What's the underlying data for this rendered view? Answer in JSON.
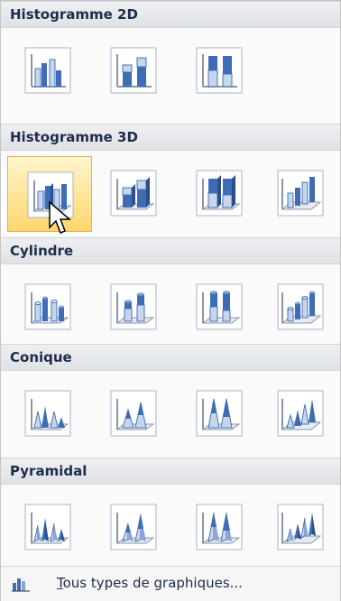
{
  "sections": [
    {
      "title": "Histogramme 2D",
      "charts": [
        "hist2d-clustered",
        "hist2d-stacked",
        "hist2d-stacked100"
      ]
    },
    {
      "title": "Histogramme 3D",
      "charts": [
        "hist3d-clustered",
        "hist3d-stacked",
        "hist3d-stacked100",
        "hist3d-column"
      ]
    },
    {
      "title": "Cylindre",
      "charts": [
        "cyl-clustered",
        "cyl-stacked",
        "cyl-stacked100",
        "cyl-column"
      ]
    },
    {
      "title": "Conique",
      "charts": [
        "cone-clustered",
        "cone-stacked",
        "cone-stacked100",
        "cone-column"
      ]
    },
    {
      "title": "Pyramidal",
      "charts": [
        "pyr-clustered",
        "pyr-stacked",
        "pyr-stacked100",
        "pyr-column"
      ]
    }
  ],
  "footer": {
    "label": "Tous types de graphiques...",
    "icon": "column-chart-icon"
  },
  "colors": {
    "header_bg": "#e3e6ea",
    "header_text": "#1e2d4a",
    "chart_dark": "#3f6db5",
    "chart_light": "#c7d6ef",
    "selected_bg": "#ffd66e",
    "selected_border": "#e2b24a"
  }
}
